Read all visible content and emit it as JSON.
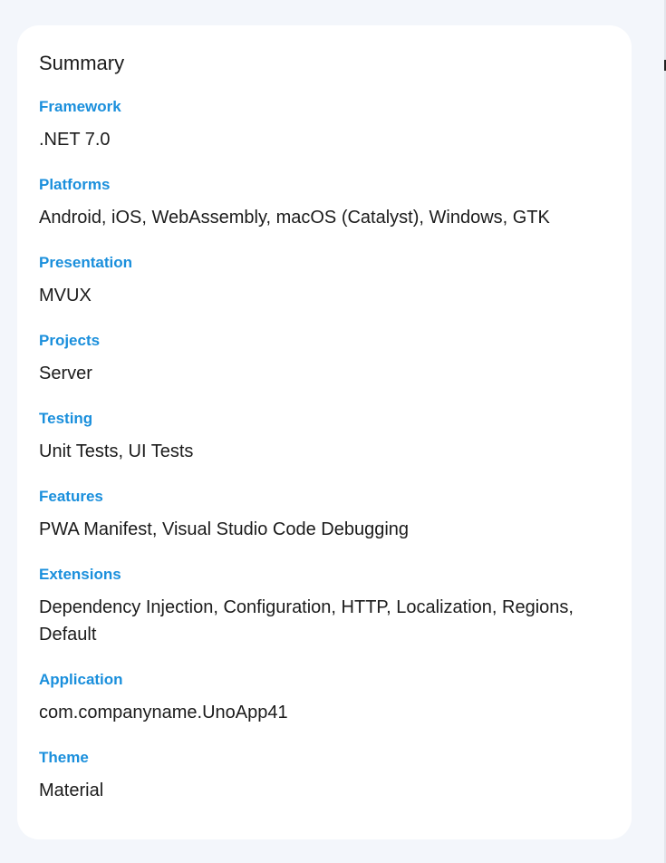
{
  "summary": {
    "title": "Summary",
    "sections": [
      {
        "label": "Framework",
        "value": ".NET 7.0"
      },
      {
        "label": "Platforms",
        "value": "Android, iOS, WebAssembly, macOS (Catalyst), Windows, GTK"
      },
      {
        "label": "Presentation",
        "value": "MVUX"
      },
      {
        "label": "Projects",
        "value": "Server"
      },
      {
        "label": "Testing",
        "value": "Unit Tests, UI Tests"
      },
      {
        "label": "Features",
        "value": "PWA Manifest, Visual Studio Code Debugging"
      },
      {
        "label": "Extensions",
        "value": "Dependency Injection, Configuration, HTTP, Localization, Regions, Default"
      },
      {
        "label": "Application",
        "value": "com.companyname.UnoApp41"
      },
      {
        "label": "Theme",
        "value": "Material"
      }
    ]
  },
  "colors": {
    "background": "#f3f6fb",
    "card": "#ffffff",
    "label": "#1a8fdc",
    "text": "#1b1b1b"
  }
}
